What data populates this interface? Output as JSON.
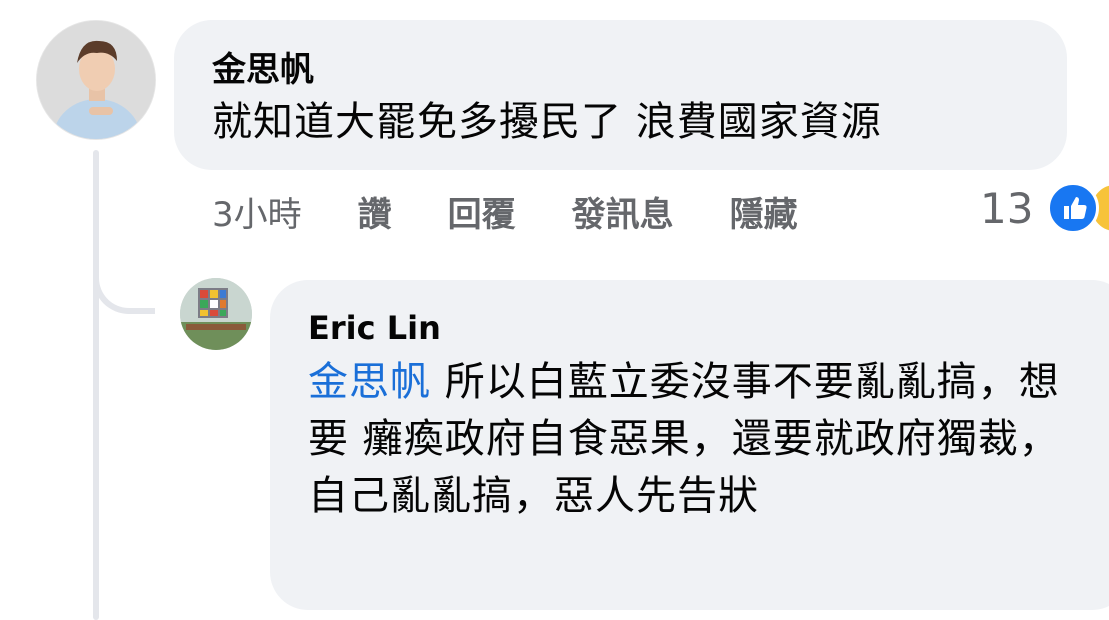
{
  "comment": {
    "author": "金思帆",
    "text": "就知道大罷免多擾民了 浪費國家資源",
    "time": "3小時",
    "actions": {
      "like": "讚",
      "reply": "回覆",
      "message": "發訊息",
      "hide": "隱藏"
    },
    "reaction_count": "13",
    "reaction_icons": [
      "like-icon",
      "haha-icon"
    ]
  },
  "reply": {
    "author": "Eric Lin",
    "mention": "金思帆",
    "text": " 所以白藍立委沒事不要亂亂搞，想要 癱瘓政府自食惡果，還要就政府獨裁，自己亂亂搞，惡人先告狀"
  },
  "colors": {
    "bubble": "#f0f2f5",
    "mention": "#1a6fd8",
    "meta": "#65676b",
    "like": "#1877f2"
  }
}
